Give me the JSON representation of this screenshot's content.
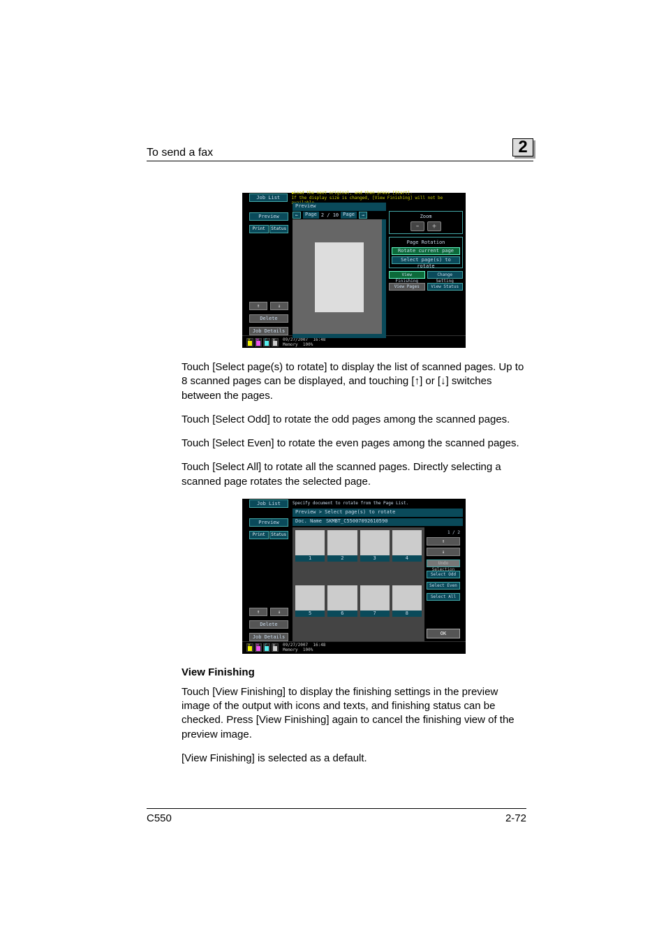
{
  "header": {
    "title": "To send a fax",
    "chapter": "2"
  },
  "footer": {
    "model": "C550",
    "page": "2-72"
  },
  "para1": "Touch [Select page(s) to rotate] to display the list of scanned pages. Up to 8 scanned pages can be displayed, and touching [↑] or [↓] switches between the pages.",
  "para2": "Touch [Select Odd] to rotate the odd pages among the scanned pages.",
  "para3": "Touch [Select Even] to rotate the even pages among the scanned pages.",
  "para4": "Touch [Select All] to rotate all the scanned pages. Directly selecting a scanned page rotates the selected page.",
  "sectionTitle": "View Finishing",
  "para5": "Touch [View Finishing] to display the finishing settings in the preview image of the output with icons and texts, and finishing status can be checked. Press [View Finishing] again to cancel the finishing view of the preview image.",
  "para6": "[View Finishing] is selected as a default.",
  "ss1": {
    "jobList": "Job List",
    "msgLine1": "◆Load the next original, and then press [Start].",
    "msgLine2": "If the display size is changed, [View Finishing] will not be available.",
    "preview": "Preview",
    "tab1": "Print",
    "tab2": "Status",
    "delete": "Delete",
    "jobDetails": "Job Details",
    "previewHeader": "Preview",
    "pageLeft": "Page",
    "pageCount": "2 / 10",
    "pageRight": "Page",
    "zoom": "Zoom",
    "pageRotation": "Page Rotation",
    "rotateCurrent": "Rotate current page",
    "selectPages": "Select page(s) to rotate",
    "viewFinishing": "View Finishing",
    "changeSetting": "Change Setting",
    "viewPages": "View Pages",
    "viewStatus": "View Status",
    "date": "09/27/2007",
    "time": "16:48",
    "memoryLabel": "Memory",
    "memory": "100%",
    "toners": {
      "y": "Y",
      "m": "M",
      "c": "C",
      "k": "K"
    }
  },
  "ss2": {
    "jobList": "Job List",
    "topMsg": "Specify document to rotate from the Page List.",
    "preview": "Preview",
    "tab1": "Print",
    "tab2": "Status",
    "delete": "Delete",
    "jobDetails": "Job Details",
    "breadcrumb": "Preview > Select page(s) to rotate",
    "docLabel": "Doc. Name",
    "docName": "SKMBT_C55007092610590",
    "cells": [
      "1",
      "2",
      "3",
      "4",
      "5",
      "6",
      "7",
      "8"
    ],
    "pageIndicator": "1 / 2",
    "undoSel": "Undo Selection",
    "selectOdd": "Select Odd",
    "selectEven": "Select Even",
    "selectAll": "Select All",
    "ok": "OK",
    "date": "09/27/2007",
    "time": "16:48",
    "memoryLabel": "Memory",
    "memory": "100%"
  }
}
